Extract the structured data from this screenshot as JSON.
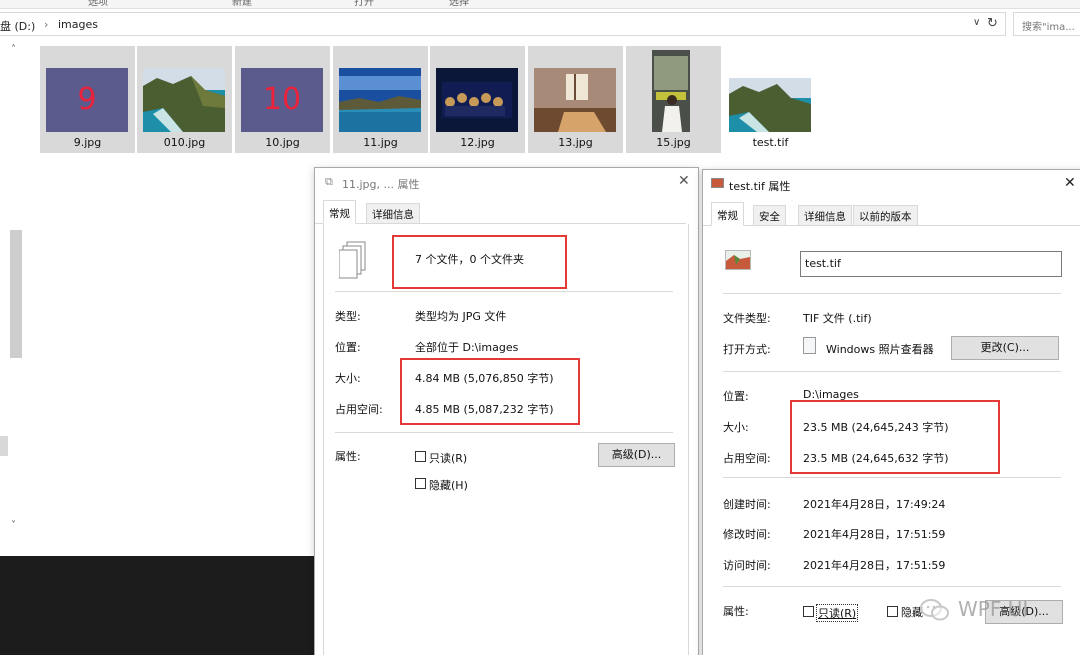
{
  "explorer": {
    "ribbon_tabs": [
      "选项",
      "新建",
      "打开",
      "选择"
    ],
    "breadcrumb": {
      "drive": "盘 (D:)",
      "separator": "›",
      "folder": "images"
    },
    "search_placeholder": "搜索\"ima...",
    "files": [
      {
        "name": "9.jpg",
        "thumb_text": "9"
      },
      {
        "name": "010.jpg",
        "thumb_text": ""
      },
      {
        "name": "10.jpg",
        "thumb_text": "10"
      },
      {
        "name": "11.jpg",
        "thumb_text": ""
      },
      {
        "name": "12.jpg",
        "thumb_text": ""
      },
      {
        "name": "13.jpg",
        "thumb_text": ""
      },
      {
        "name": "15.jpg",
        "thumb_text": ""
      },
      {
        "name": "test.tif",
        "thumb_text": ""
      }
    ]
  },
  "dialog_jpg": {
    "title": "11.jpg, ... 属性",
    "tabs": [
      "常规",
      "详细信息"
    ],
    "summary": "7 个文件，0 个文件夹",
    "type_label": "类型:",
    "type_value": "类型均为 JPG 文件",
    "location_label": "位置:",
    "location_value": "全部位于 D:\\images",
    "size_label": "大小:",
    "size_value": "4.84 MB (5,076,850 字节)",
    "disk_label": "占用空间:",
    "disk_value": "4.85 MB (5,087,232 字节)",
    "attr_label": "属性:",
    "readonly": "只读(R)",
    "hidden": "隐藏(H)",
    "advanced_button": "高级(D)..."
  },
  "dialog_tif": {
    "title": "test.tif 属性",
    "tabs": [
      "常规",
      "安全",
      "详细信息",
      "以前的版本"
    ],
    "filename": "test.tif",
    "filetype_label": "文件类型:",
    "filetype_value": "TIF 文件 (.tif)",
    "openwith_label": "打开方式:",
    "openwith_value": "Windows 照片查看器",
    "change_button": "更改(C)...",
    "location_label": "位置:",
    "location_value": "D:\\images",
    "size_label": "大小:",
    "size_value": "23.5 MB (24,645,243 字节)",
    "disk_label": "占用空间:",
    "disk_value": "23.5 MB (24,645,632 字节)",
    "created_label": "创建时间:",
    "created_value": "2021年4月28日，17:49:24",
    "modified_label": "修改时间:",
    "modified_value": "2021年4月28日，17:51:59",
    "accessed_label": "访问时间:",
    "accessed_value": "2021年4月28日，17:51:59",
    "attr_label": "属性:",
    "readonly": "只读(R)",
    "hidden": "隐藏",
    "advanced_button": "高级(D)..."
  },
  "watermark": "WPF UI",
  "colors": {
    "highlight": "#e53935",
    "tile_bg": "#d9d9d9",
    "dark_panel": "#1c1c1c"
  }
}
